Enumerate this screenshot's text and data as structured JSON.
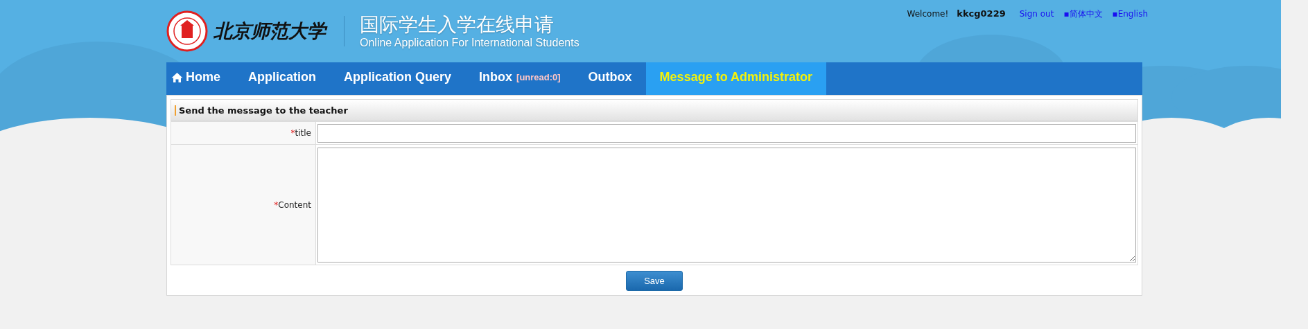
{
  "header": {
    "logo_name": "北京师范大学",
    "title_cn": "国际学生入学在线申请",
    "title_en": "Online Application For International Students"
  },
  "user_bar": {
    "greeting": "Welcome!",
    "username": "kkcg0229",
    "links": [
      "Sign out",
      "▪简体中文",
      "▪English"
    ]
  },
  "nav": [
    {
      "label": "Home",
      "kind": "home",
      "selected": false
    },
    {
      "label": "Application",
      "kind": "plain",
      "selected": false
    },
    {
      "label": "Application Query",
      "kind": "plain",
      "selected": false
    },
    {
      "label": "Inbox",
      "kind": "inbox",
      "badge": "[unread:0]",
      "selected": false
    },
    {
      "label": "Outbox",
      "kind": "plain",
      "selected": false
    },
    {
      "label": "Message to Administrator",
      "kind": "plain",
      "selected": true
    }
  ],
  "form": {
    "heading": "Send the message to the teacher",
    "fields": [
      {
        "required_mark": "*",
        "label": "title",
        "kind": "line"
      },
      {
        "required_mark": "*",
        "label": "Content",
        "kind": "area"
      }
    ],
    "save": "Save"
  }
}
